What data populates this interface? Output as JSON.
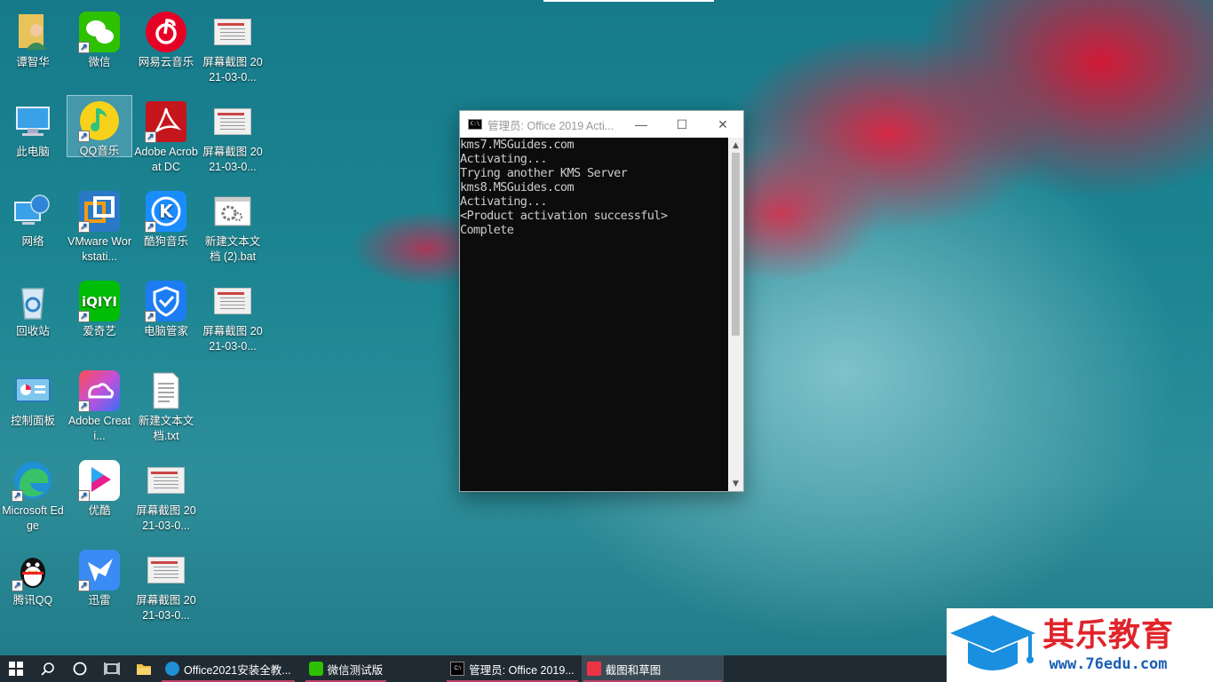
{
  "desktop": {
    "icons": [
      {
        "label": "谭智华",
        "icon": "user-folder-icon"
      },
      {
        "label": "微信",
        "icon": "wechat-icon"
      },
      {
        "label": "网易云音乐",
        "icon": "netease-music-icon"
      },
      {
        "label": "屏幕截图 2021-03-0...",
        "icon": "screenshot-file-icon"
      },
      {
        "label": "此电脑",
        "icon": "this-pc-icon"
      },
      {
        "label": "QQ音乐",
        "icon": "qq-music-icon"
      },
      {
        "label": "Adobe Acrobat DC",
        "icon": "acrobat-icon"
      },
      {
        "label": "屏幕截图 2021-03-0...",
        "icon": "screenshot-file-icon"
      },
      {
        "label": "网络",
        "icon": "network-icon"
      },
      {
        "label": "VMware Workstati...",
        "icon": "vmware-icon"
      },
      {
        "label": "酷狗音乐",
        "icon": "kugou-icon"
      },
      {
        "label": "新建文本文档 (2).bat",
        "icon": "bat-file-icon"
      },
      {
        "label": "回收站",
        "icon": "recycle-bin-icon"
      },
      {
        "label": "爱奇艺",
        "icon": "iqiyi-icon"
      },
      {
        "label": "电脑管家",
        "icon": "pc-manager-icon"
      },
      {
        "label": "屏幕截图 2021-03-0...",
        "icon": "screenshot-file-icon"
      },
      {
        "label": "控制面板",
        "icon": "control-panel-icon"
      },
      {
        "label": "Adobe Creati...",
        "icon": "creative-cloud-icon"
      },
      {
        "label": "新建文本文档.txt",
        "icon": "txt-file-icon"
      },
      {
        "label": "Microsoft Edge",
        "icon": "edge-icon"
      },
      {
        "label": "优酷",
        "icon": "youku-icon"
      },
      {
        "label": "屏幕截图 2021-03-0...",
        "icon": "screenshot-file-icon"
      },
      {
        "label": "腾讯QQ",
        "icon": "qq-icon"
      },
      {
        "label": "迅雷",
        "icon": "xunlei-icon"
      },
      {
        "label": "屏幕截图 2021-03-0...",
        "icon": "screenshot-file-icon"
      }
    ]
  },
  "console": {
    "title": "管理员:  Office 2019 Acti...",
    "lines": [
      "kms7.MSGuides.com",
      "Activating...",
      "Trying another KMS Server",
      "kms8.MSGuides.com",
      "Activating...",
      "<Product activation successful>",
      "Complete"
    ]
  },
  "taskbar": {
    "apps": [
      {
        "label": "Office2021安装全教...",
        "icon": "edge-icon"
      },
      {
        "label": "微信测试版",
        "icon": "wechat-icon"
      },
      {
        "label": "管理员:  Office 2019...",
        "icon": "cmd-icon"
      },
      {
        "label": "截图和草图",
        "icon": "snip-sketch-icon"
      }
    ]
  },
  "watermark": {
    "title": "其乐教育",
    "url": "www.76edu.com"
  },
  "colors": {
    "accent_red": "#e0242b",
    "accent_blue": "#1a5fb4",
    "taskbar_bg": "#1f2a32"
  }
}
